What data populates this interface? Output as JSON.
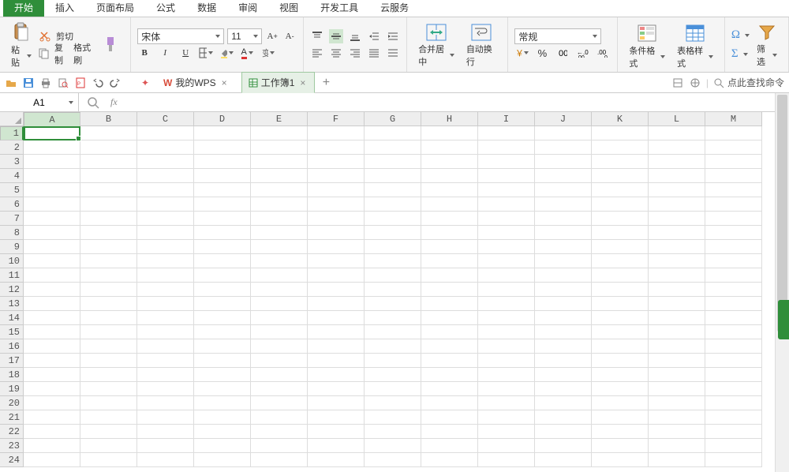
{
  "menu": {
    "tabs": [
      "开始",
      "插入",
      "页面布局",
      "公式",
      "数据",
      "审阅",
      "视图",
      "开发工具",
      "云服务"
    ],
    "active": 0
  },
  "ribbon": {
    "paste": "粘贴",
    "cut": "剪切",
    "copy": "复制",
    "formatpainter": "格式刷",
    "font_name": "宋体",
    "font_size": "11",
    "merge": "合并居中",
    "wrap": "自动换行",
    "numfmt": "常规",
    "condfmt": "条件格式",
    "tablestyle": "表格样式",
    "filter": "筛选"
  },
  "doctabs": {
    "items": [
      {
        "label": "我的WPS",
        "active": false,
        "color": "#d84c3a"
      },
      {
        "label": "工作簿1",
        "active": true,
        "color": "#2f8e3a"
      }
    ]
  },
  "search_placeholder": "点此查找命令",
  "namebox_value": "A1",
  "columns": [
    "A",
    "B",
    "C",
    "D",
    "E",
    "F",
    "G",
    "H",
    "I",
    "J",
    "K",
    "L",
    "M"
  ],
  "rows": [
    1,
    2,
    3,
    4,
    5,
    6,
    7,
    8,
    9,
    10,
    11,
    12,
    13,
    14,
    15,
    16,
    17,
    18,
    19,
    20,
    21,
    22,
    23,
    24
  ],
  "selected": {
    "row": 1,
    "col": "A"
  }
}
